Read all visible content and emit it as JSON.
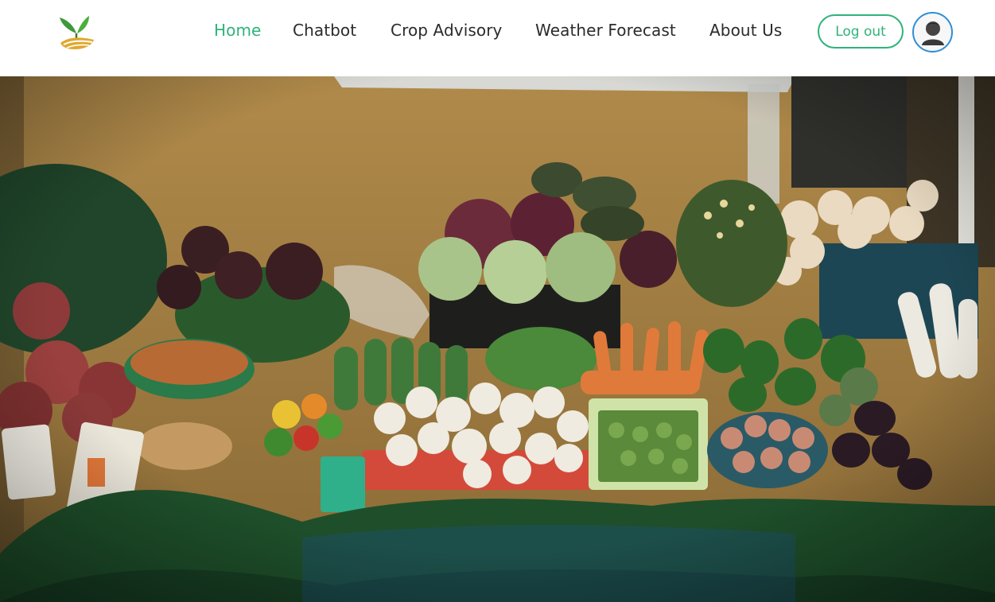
{
  "navbar": {
    "logo": {
      "icon": "sprout-logo-icon"
    },
    "links": [
      {
        "label": "Home",
        "active": true
      },
      {
        "label": "Chatbot",
        "active": false
      },
      {
        "label": "Crop Advisory",
        "active": false
      },
      {
        "label": "Weather Forecast",
        "active": false
      },
      {
        "label": "About Us",
        "active": false
      }
    ],
    "logout_label": "Log out",
    "avatar": {
      "icon": "user-avatar-icon"
    }
  },
  "hero": {
    "image": "vegetable-market-stall-photo"
  },
  "colors": {
    "accent": "#2fb37a",
    "text": "#2b2b2b",
    "avatar_ring": "#2e8ed6"
  }
}
